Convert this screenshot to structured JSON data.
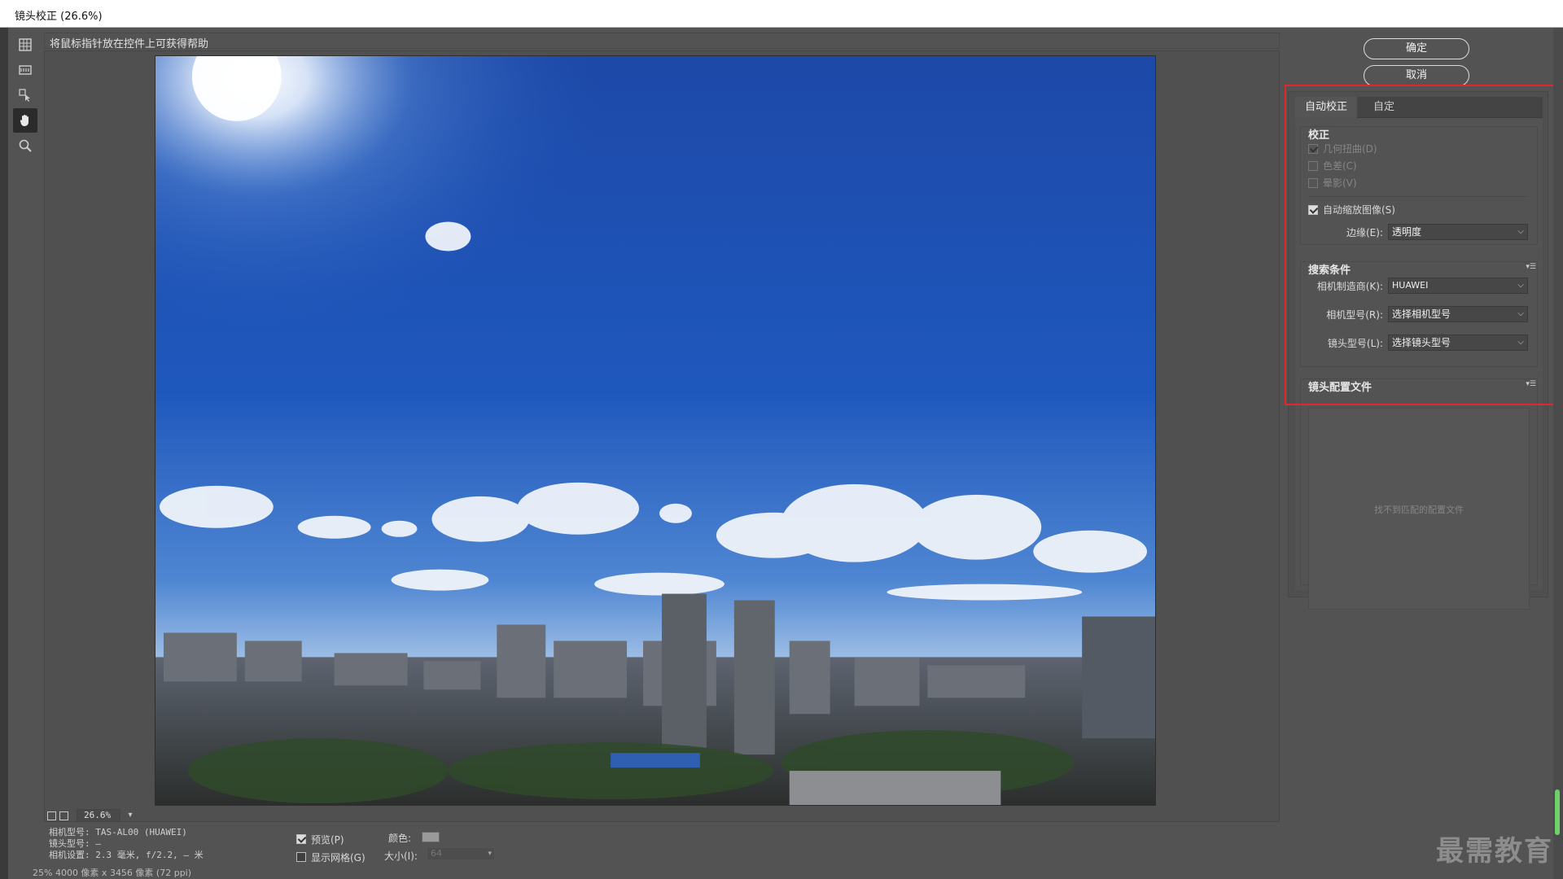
{
  "window": {
    "title": "镜头校正 (26.6%)"
  },
  "help_text": "将鼠标指针放在控件上可获得帮助",
  "tools": [
    {
      "name": "remove-distortion-icon"
    },
    {
      "name": "straighten-icon"
    },
    {
      "name": "move-grid-icon"
    },
    {
      "name": "hand-icon",
      "active": true
    },
    {
      "name": "zoom-icon"
    }
  ],
  "zoom": {
    "value": "26.6%"
  },
  "info": {
    "camera": "相机型号: TAS-AL00 (HUAWEI)",
    "lens": "镜头型号: —",
    "settings": "相机设置: 2.3 毫米, f/2.2, — 米"
  },
  "options": {
    "preview_label": "预览(P)",
    "preview_checked": true,
    "grid_label": "显示网格(G)",
    "grid_checked": false,
    "color_label": "颜色:",
    "size_label": "大小(I):",
    "size_value": "64"
  },
  "status": {
    "text": "25%      4000 像素 x 3456 像素 (72 ppi)"
  },
  "buttons": {
    "ok": "确定",
    "cancel": "取消"
  },
  "tabs": {
    "auto": "自动校正",
    "custom": "自定"
  },
  "correction": {
    "title": "校正",
    "geometric": "几何扭曲(D)",
    "chromatic": "色差(C)",
    "vignette": "晕影(V)",
    "auto_scale": "自动缩放图像(S)",
    "auto_scale_checked": true,
    "edge_label": "边缘(E):",
    "edge_value": "透明度"
  },
  "search": {
    "title": "搜索条件",
    "maker_label": "相机制造商(K):",
    "maker_value": "HUAWEI",
    "model_label": "相机型号(R):",
    "model_value": "选择相机型号",
    "lens_label": "镜头型号(L):",
    "lens_value": "选择镜头型号"
  },
  "profiles": {
    "title": "镜头配置文件",
    "empty": "找不到匹配的配置文件"
  },
  "watermark": "最需教育",
  "colors": {
    "highlight": "#e2262b",
    "sky": "#1f56b3",
    "panel": "#535353"
  }
}
